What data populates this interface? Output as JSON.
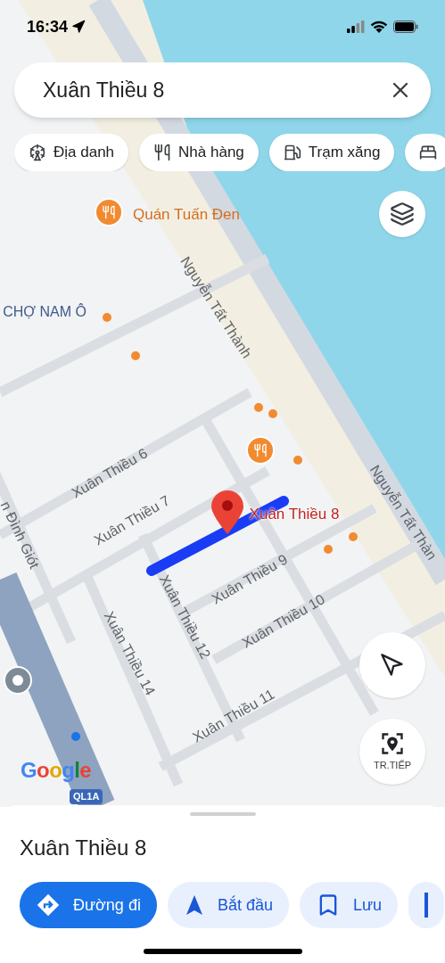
{
  "status_bar": {
    "time": "16:34"
  },
  "search": {
    "value": "Xuân Thiều 8"
  },
  "chips": [
    {
      "label": "Địa danh",
      "kind": "landmark"
    },
    {
      "label": "Nhà hàng",
      "kind": "restaurant"
    },
    {
      "label": "Trạm xăng",
      "kind": "fuel"
    },
    {
      "kind": "hotel"
    }
  ],
  "map": {
    "labels": [
      {
        "text": "Quán Tuấn Đen",
        "kind": "poi"
      },
      {
        "text": "CHỢ NAM Ô",
        "kind": "area"
      },
      {
        "text": "Nguyễn Tất Thành",
        "kind": "street"
      },
      {
        "text": "Nguyễn Tất Thàn",
        "kind": "street"
      },
      {
        "text": "Xuân Thiều 6",
        "kind": "street"
      },
      {
        "text": "Xuân Thiều 7",
        "kind": "street"
      },
      {
        "text": "Xuân Thiều 8",
        "kind": "result"
      },
      {
        "text": "Xuân Thiều 9",
        "kind": "street"
      },
      {
        "text": "Xuân Thiều 10",
        "kind": "street"
      },
      {
        "text": "Xuân Thiều 11",
        "kind": "street"
      },
      {
        "text": "Xuân Thiều 12",
        "kind": "street"
      },
      {
        "text": "Xuân Thiều 14",
        "kind": "street"
      },
      {
        "text": "n Đình Giót",
        "kind": "street"
      }
    ],
    "highway_shield": "QL1A",
    "logo": "Google",
    "live_view_button": "TR.TIẾP"
  },
  "place": {
    "title": "Xuân Thiều 8",
    "actions": [
      {
        "label": "Đường đi",
        "kind": "directions",
        "primary": true
      },
      {
        "label": "Bắt đầu",
        "kind": "start",
        "primary": false
      },
      {
        "label": "Lưu",
        "kind": "save",
        "primary": false
      },
      {
        "kind": "more",
        "primary": false
      }
    ]
  }
}
